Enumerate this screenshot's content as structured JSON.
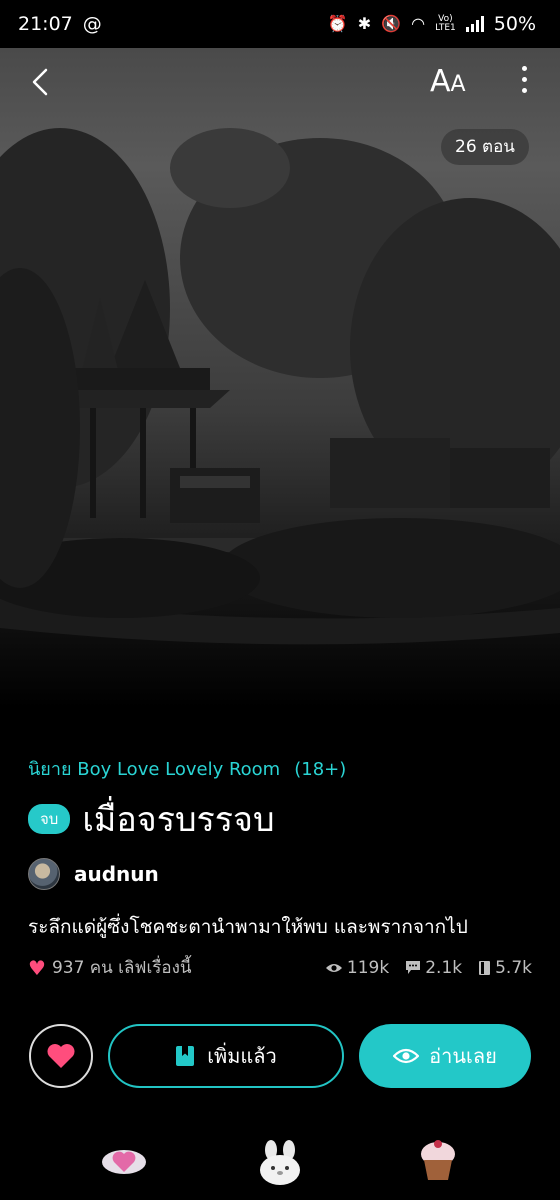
{
  "status_bar": {
    "time": "21:07",
    "at_symbol": "@",
    "battery": "50%",
    "network": "LTE1",
    "volte": "Vo)"
  },
  "header": {
    "font_button_label_big": "A",
    "font_button_label_small": "A",
    "episodes_badge": "26 ตอน"
  },
  "story": {
    "category": "นิยาย Boy Love Lovely Room",
    "rating": "(18+)",
    "status": "จบ",
    "title": "เมื่อจรบรรจบ",
    "author": "audnun",
    "synopsis": "ระลึกแด่ผู้ซึ่งโชคชะตานำพามาให้พบ และพรากจากไป",
    "likes_text": "937 คน เลิฟเรื่องนี้",
    "views": "119k",
    "comments": "2.1k",
    "favorites": "5.7k"
  },
  "actions": {
    "add_label": "เพิ่มแล้ว",
    "read_label": "อ่านเลย"
  },
  "colors": {
    "accent": "#23c8c8",
    "heart": "#ff4d7d"
  }
}
